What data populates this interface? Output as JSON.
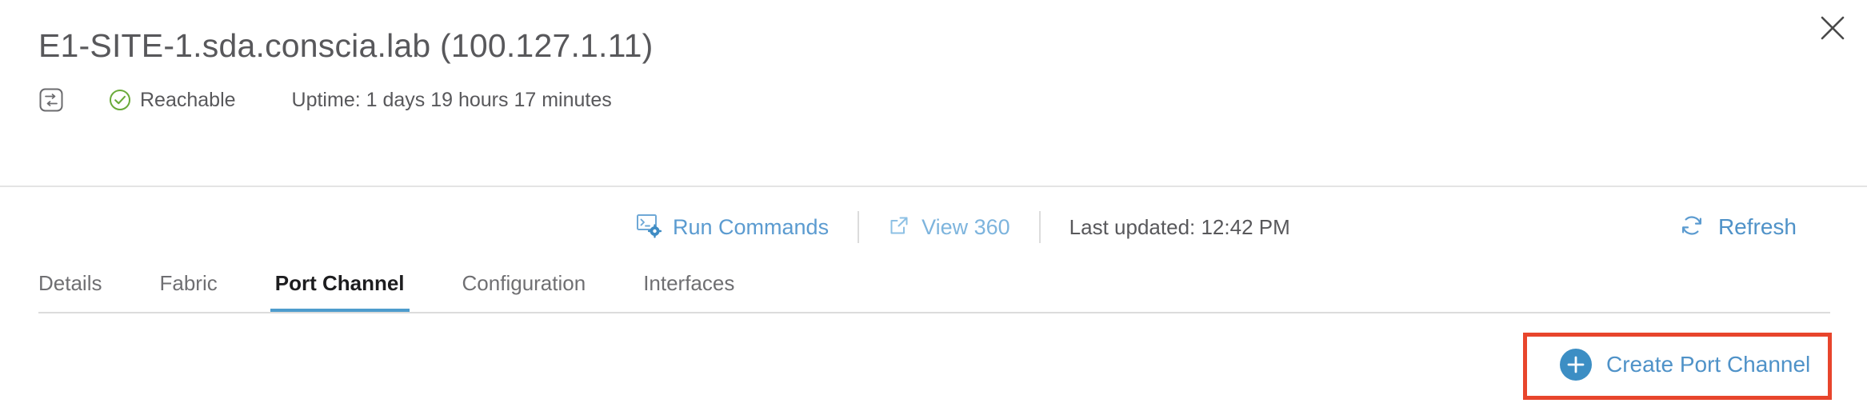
{
  "header": {
    "title": "E1-SITE-1.sda.conscia.lab (100.127.1.11)",
    "device_icon": "network-device-icon",
    "status_icon": "check-circle-icon",
    "status_text": "Reachable",
    "uptime_text": "Uptime: 1 days 19 hours 17 minutes",
    "close_icon": "close-icon"
  },
  "action_bar": {
    "run_commands": {
      "label": "Run Commands",
      "icon": "terminal-gear-icon"
    },
    "view_360": {
      "label": "View 360",
      "icon": "external-link-icon"
    },
    "last_updated": "Last updated: 12:42 PM",
    "refresh": {
      "label": "Refresh",
      "icon": "refresh-icon"
    }
  },
  "tabs": [
    {
      "label": "Details",
      "active": false
    },
    {
      "label": "Fabric",
      "active": false
    },
    {
      "label": "Port Channel",
      "active": true
    },
    {
      "label": "Configuration",
      "active": false
    },
    {
      "label": "Interfaces",
      "active": false
    }
  ],
  "content": {
    "create_button": {
      "label": "Create Port Channel",
      "icon": "plus-circle-icon"
    },
    "highlight_color": "#e8452c"
  },
  "colors": {
    "link_blue": "#4f92c8",
    "accent_blue": "#4e9ccd",
    "status_green": "#6aaa3a",
    "text_gray": "#58585b",
    "highlight_red": "#e8452c"
  }
}
